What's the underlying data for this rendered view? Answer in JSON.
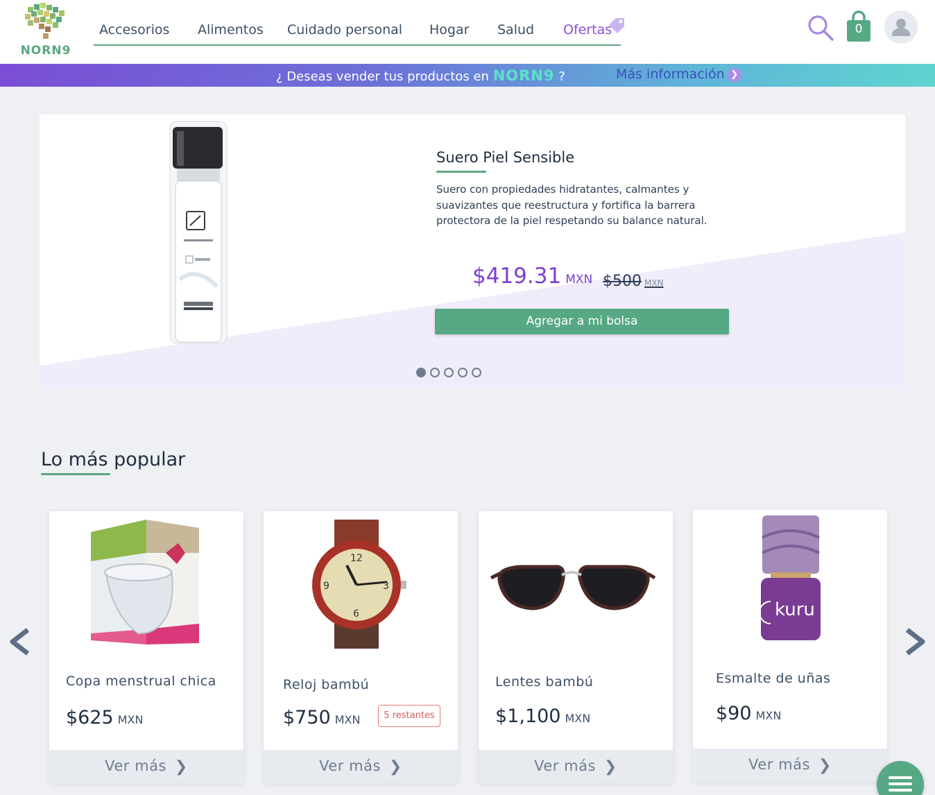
{
  "brand": {
    "name": "NORN9",
    "colors": {
      "green": "#57a884",
      "purple": "#7c3fd0",
      "text": "#2c3e55"
    }
  },
  "nav": {
    "items": [
      {
        "label": "Accesorios"
      },
      {
        "label": "Alimentos"
      },
      {
        "label": "Cuidado personal"
      },
      {
        "label": "Hogar"
      },
      {
        "label": "Salud"
      },
      {
        "label": "Ofertas"
      }
    ]
  },
  "header": {
    "cart_count": "0",
    "icons": [
      "search-icon",
      "shopping-bag-icon",
      "user-icon",
      "tag-icon"
    ]
  },
  "promo": {
    "prefix": "¿ Deseas vender tus productos en",
    "brand": "NORN9",
    "suffix": "?",
    "link_label": "Más información",
    "link_icon": "chevron-right-icon"
  },
  "hero": {
    "title": "Suero Piel Sensible",
    "description": "Suero con propiedades hidratantes, calmantes y suavizantes que reestructura y fortifica la barrera protectora de la piel respetando su balance natural.",
    "price": "$419.31",
    "currency": "MXN",
    "old_price": "$500",
    "old_currency": "MXN",
    "button_label": "Agregar a mi bolsa",
    "slide_count": 5,
    "active_slide": 1
  },
  "popular": {
    "title": "Lo más popular",
    "cards": [
      {
        "name": "Copa menstrual chica",
        "price": "$625",
        "currency": "MXN",
        "more_label": "Ver más"
      },
      {
        "name": "Reloj bambú",
        "price": "$750",
        "currency": "MXN",
        "stock": "5 restantes",
        "more_label": "Ver más"
      },
      {
        "name": "Lentes bambú",
        "price": "$1,100",
        "currency": "MXN",
        "more_label": "Ver más"
      },
      {
        "name": "Esmalte de uñas",
        "price": "$90",
        "currency": "MXN",
        "more_label": "Ver más"
      }
    ]
  }
}
